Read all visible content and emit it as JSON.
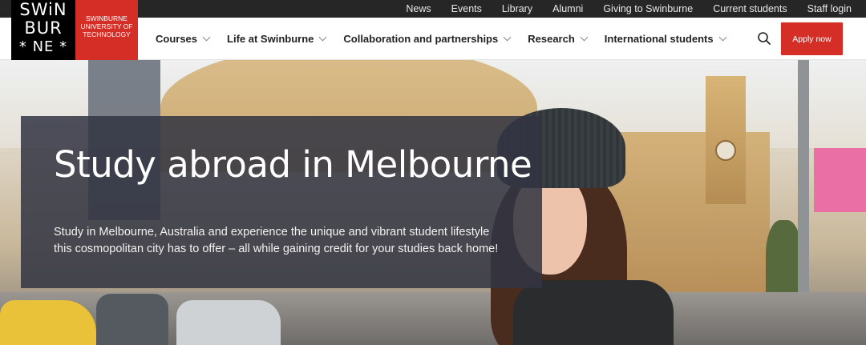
{
  "top_links": [
    "News",
    "Events",
    "Library",
    "Alumni",
    "Giving to Swinburne",
    "Current students",
    "Staff login"
  ],
  "logo": {
    "mark_rows": [
      "SWiN",
      "BUR",
      "* NE *"
    ],
    "wordmark": [
      "Swinburne",
      "University of",
      "Technology"
    ]
  },
  "nav": {
    "items": [
      {
        "label": "Courses"
      },
      {
        "label": "Life at Swinburne"
      },
      {
        "label": "Collaboration and partnerships"
      },
      {
        "label": "Research"
      },
      {
        "label": "International students"
      }
    ],
    "apply_label": "Apply now"
  },
  "hero": {
    "title": "Study abroad in Melbourne",
    "body": "Study in Melbourne, Australia and experience the unique and vibrant student lifestyle this cosmopolitan city has to offer – all while gaining credit for your studies back home!"
  },
  "colors": {
    "brand_red": "#d42e27",
    "topbar": "#262626",
    "panel": "rgba(50,52,66,0.86)"
  }
}
